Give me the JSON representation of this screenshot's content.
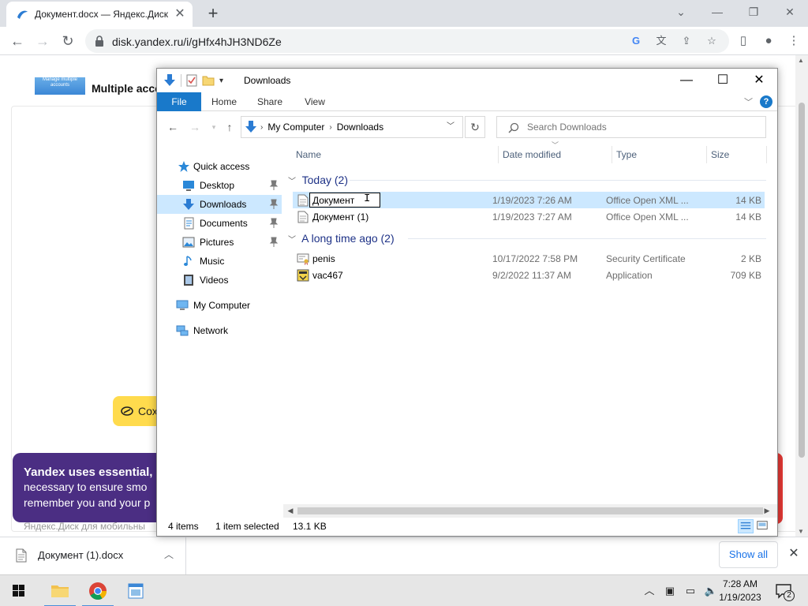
{
  "browser": {
    "tab_title": "Документ.docx — Яндекс.Диск",
    "url": "disk.yandex.ru/i/gHfx4hJH3ND6Ze"
  },
  "page": {
    "heading": "Multiple acco",
    "logo_text": "Manage multiple accounts",
    "save_button": "Сох",
    "cookie_title": "Yandex uses essential,",
    "cookie_line1": "necessary to ensure smo",
    "cookie_line2": "remember you and your p",
    "footer_text": "Яндекс.Диск для мобильны"
  },
  "downloads_bar": {
    "file_name": "Документ (1).docx",
    "show_all": "Show all"
  },
  "taskbar": {
    "time": "7:28 AM",
    "date": "1/19/2023",
    "notification_count": "2"
  },
  "explorer": {
    "title": "Downloads",
    "ribbon_tabs": [
      "File",
      "Home",
      "Share",
      "View"
    ],
    "breadcrumbs": [
      "My Computer",
      "Downloads"
    ],
    "search_placeholder": "Search Downloads",
    "nav": {
      "quick_access": "Quick access",
      "desktop": "Desktop",
      "downloads": "Downloads",
      "documents": "Documents",
      "pictures": "Pictures",
      "music": "Music",
      "videos": "Videos",
      "my_computer": "My Computer",
      "network": "Network"
    },
    "columns": {
      "name": "Name",
      "date_modified": "Date modified",
      "type": "Type",
      "size": "Size"
    },
    "groups": {
      "today": "Today (2)",
      "long_ago": "A long time ago (2)"
    },
    "files": [
      {
        "name": "Документ",
        "date": "1/19/2023 7:26 AM",
        "type": "Office Open XML ...",
        "size": "14 KB"
      },
      {
        "name": "Документ (1)",
        "date": "1/19/2023 7:27 AM",
        "type": "Office Open XML ...",
        "size": "14 KB"
      },
      {
        "name": "penis",
        "date": "10/17/2022 7:58 PM",
        "type": "Security Certificate",
        "size": "2 KB"
      },
      {
        "name": "vac467",
        "date": "9/2/2022 11:37 AM",
        "type": "Application",
        "size": "709 KB"
      }
    ],
    "status": {
      "items": "4 items",
      "selected": "1 item selected",
      "size": "13.1 KB"
    }
  },
  "colors": {
    "accent": "#1979ca",
    "selection": "#cce8ff",
    "group_heading": "#1e3287",
    "cookie_banner": "#4b2e83",
    "save_button": "#ffdb4d"
  }
}
